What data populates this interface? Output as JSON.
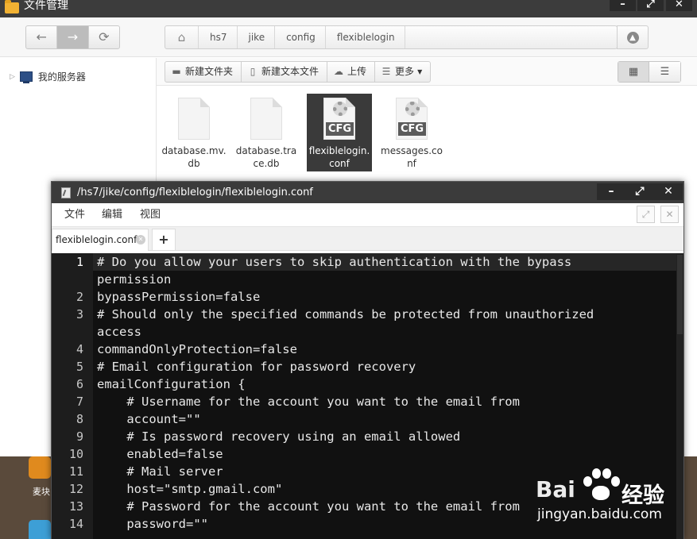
{
  "fm": {
    "title": "文件管理",
    "nav": {
      "back": "←",
      "forward": "→",
      "refresh": "⟳"
    },
    "breadcrumb": [
      "hs7",
      "jike",
      "config",
      "flexiblelogin"
    ],
    "sidebar": {
      "root": "我的服务器"
    },
    "toolbar": {
      "new_folder": "新建文件夹",
      "new_text_file": "新建文本文件",
      "upload": "上传",
      "more": "更多"
    },
    "files": [
      {
        "name": "database.mv.db",
        "type": "doc",
        "selected": false
      },
      {
        "name": "database.trace.db",
        "type": "doc",
        "selected": false
      },
      {
        "name": "flexiblelogin.conf",
        "type": "cfg",
        "cfg_label": "CFG",
        "selected": true
      },
      {
        "name": "messages.conf",
        "type": "cfg",
        "cfg_label": "CFG",
        "selected": false
      }
    ]
  },
  "desktop": {
    "label": "麦块"
  },
  "editor": {
    "path": "/hs7/jike/config/flexiblelogin/flexiblelogin.conf",
    "menu": [
      "文件",
      "编辑",
      "视图"
    ],
    "tab": "flexiblelogin.conf",
    "add_tab": "+",
    "lines": [
      {
        "n": "1",
        "text": "# Do you allow your users to skip authentication with the bypass"
      },
      {
        "n": "",
        "text": "permission"
      },
      {
        "n": "2",
        "text": "bypassPermission=false"
      },
      {
        "n": "3",
        "text": "# Should only the specified commands be protected from unauthorized"
      },
      {
        "n": "",
        "text": "access"
      },
      {
        "n": "4",
        "text": "commandOnlyProtection=false"
      },
      {
        "n": "5",
        "text": "# Email configuration for password recovery"
      },
      {
        "n": "6",
        "text": "emailConfiguration {"
      },
      {
        "n": "7",
        "text": "    # Username for the account you want to the email from"
      },
      {
        "n": "8",
        "text": "    account=\"\""
      },
      {
        "n": "9",
        "text": "    # Is password recovery using an email allowed"
      },
      {
        "n": "10",
        "text": "    enabled=false"
      },
      {
        "n": "11",
        "text": "    # Mail server"
      },
      {
        "n": "12",
        "text": "    host=\"smtp.gmail.com\""
      },
      {
        "n": "13",
        "text": "    # Password for the account you want to the email from"
      },
      {
        "n": "14",
        "text": "    password=\"\""
      }
    ]
  },
  "watermark": {
    "brand": "Bai",
    "brand2": "经验",
    "url": "jingyan.baidu.com"
  }
}
